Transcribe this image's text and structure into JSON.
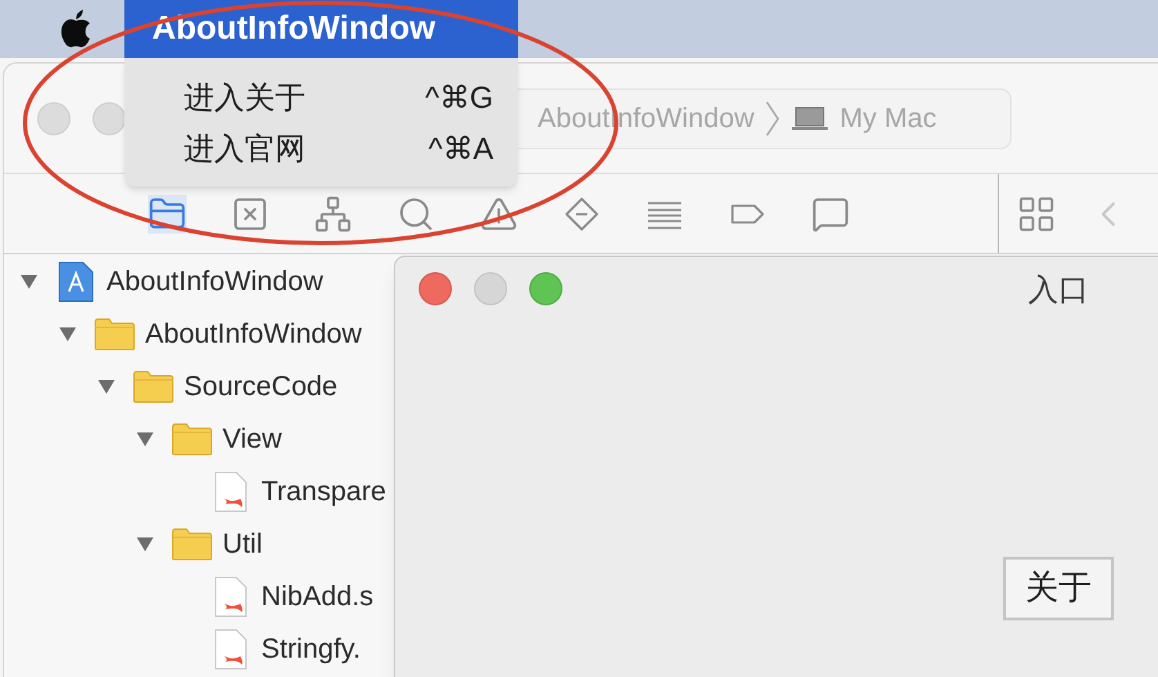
{
  "menu_bar": {
    "menus": [
      {
        "label": "AboutInfoWindow",
        "selected": true
      }
    ]
  },
  "menu": {
    "items": [
      {
        "label": "进入关于",
        "shortcut": "^⌘G"
      },
      {
        "label": "进入官网",
        "shortcut": "^⌘A"
      }
    ]
  },
  "xcode_window": {
    "breadcrumb": [
      {
        "label": "AboutInfoWindow",
        "kind": "target"
      },
      {
        "label": "My Mac",
        "kind": "device"
      }
    ],
    "navigator_tabs": [
      {
        "selected": true
      },
      {
        "selected": false
      },
      {
        "selected": false
      },
      {
        "selected": false
      },
      {
        "selected": false
      },
      {
        "selected": false
      },
      {
        "selected": false
      },
      {
        "selected": false
      },
      {
        "selected": false
      }
    ],
    "tree": [
      {
        "label": "AboutInfoWindow",
        "kind": "project",
        "expanded": true,
        "children": [
          {
            "label": "AboutInfoWindow",
            "kind": "folder",
            "expanded": true,
            "children": [
              {
                "label": "SourceCode",
                "kind": "folder",
                "expanded": true,
                "children": [
                  {
                    "label": "View",
                    "kind": "folder",
                    "expanded": true,
                    "children": [
                      {
                        "label": "Transpare",
                        "kind": "swift"
                      }
                    ]
                  },
                  {
                    "label": "Util",
                    "kind": "folder",
                    "expanded": true,
                    "children": [
                      {
                        "label": "NibAdd.s",
                        "kind": "swift"
                      },
                      {
                        "label": "Stringfy.",
                        "kind": "swift"
                      }
                    ]
                  }
                ]
              }
            ]
          }
        ]
      }
    ]
  },
  "app_window": {
    "title": "入口",
    "button": "关于"
  }
}
